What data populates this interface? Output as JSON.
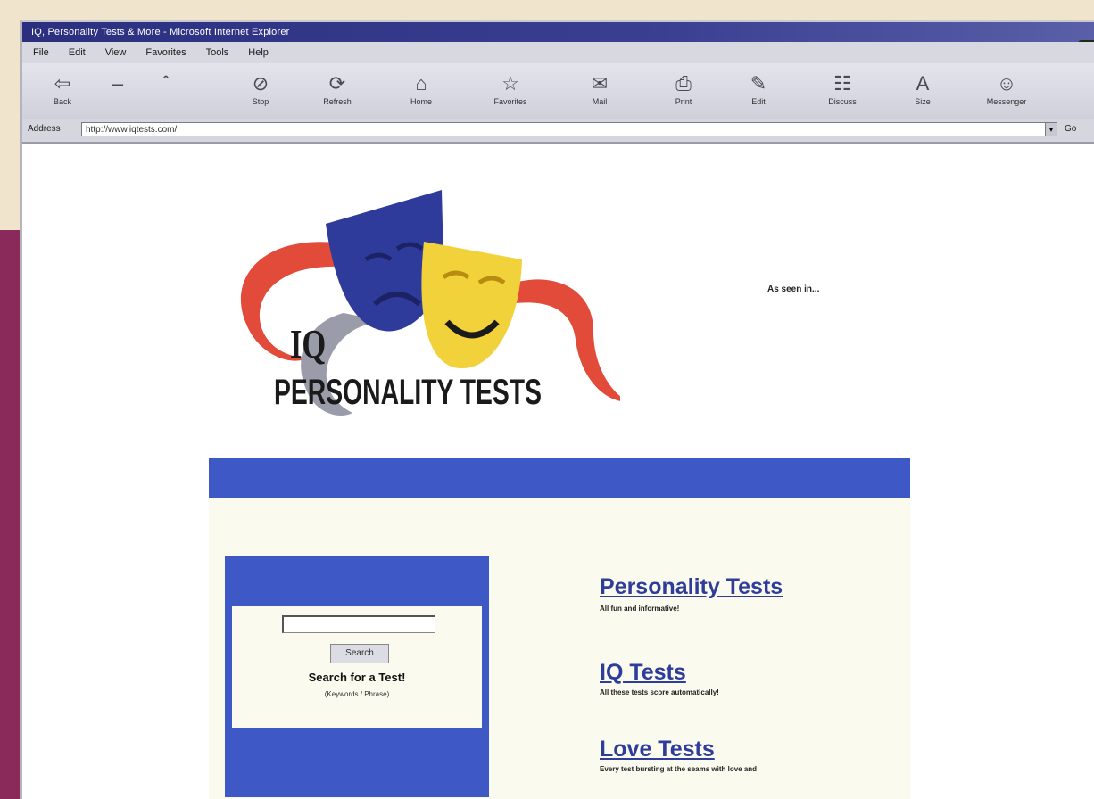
{
  "browser": {
    "title": "IQ, Personality Tests & More - Microsoft Internet Explorer",
    "menu": [
      "File",
      "Edit",
      "View",
      "Favorites",
      "Tools",
      "Help"
    ],
    "toolbar": [
      {
        "label": "Back",
        "icon": "back-arrow-icon"
      },
      {
        "label": "",
        "icon": "forward-arrow-icon"
      },
      {
        "label": "",
        "icon": "stop-icon"
      },
      {
        "label": "Stop",
        "icon": "stop-icon"
      },
      {
        "label": "Refresh",
        "icon": "refresh-icon"
      },
      {
        "label": "Home",
        "icon": "home-icon"
      },
      {
        "label": "Favorites",
        "icon": "favorites-icon"
      },
      {
        "label": "Mail",
        "icon": "mail-icon"
      },
      {
        "label": "Print",
        "icon": "print-icon"
      },
      {
        "label": "Edit",
        "icon": "edit-icon"
      },
      {
        "label": "Discuss",
        "icon": "discuss-icon"
      },
      {
        "label": "Size",
        "icon": "size-icon"
      },
      {
        "label": "Messenger",
        "icon": "messenger-icon"
      }
    ],
    "address_label": "Address",
    "address_value": "http://www.iqtests.com/",
    "go_label": "Go"
  },
  "page": {
    "logo": {
      "line1": "IQ",
      "line2": "PERSONALITY TESTS",
      "colors": {
        "blue_mask": "#2f3b9a",
        "yellow_mask": "#f2d23a",
        "ribbon": "#e24a3a"
      }
    },
    "as_seen": "As seen in...",
    "search": {
      "button_label": "Search",
      "title": "Search for a Test!",
      "sub": "(Keywords / Phrase)"
    },
    "tests": [
      {
        "title": "Personality Tests",
        "desc": "All fun and informative!"
      },
      {
        "title": "IQ Tests",
        "desc": "All these tests score automatically!"
      },
      {
        "title": "Love Tests",
        "desc": "Every test bursting at the seams with love and"
      }
    ]
  }
}
